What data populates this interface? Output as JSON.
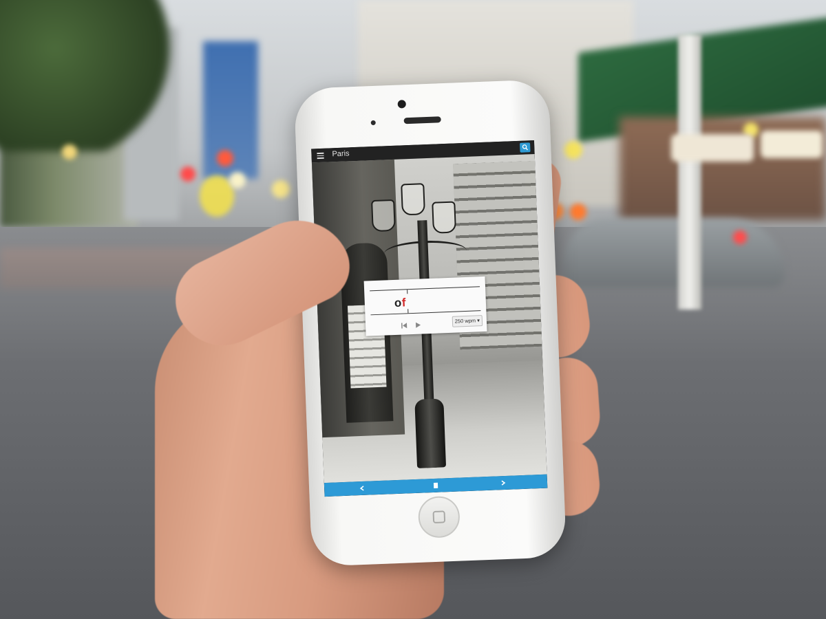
{
  "app": {
    "title": "Paris"
  },
  "reader": {
    "word_pre": "o",
    "word_pivot": "f",
    "word_post": "",
    "speed_label": "250 wpm ▾"
  },
  "icons": {
    "menu": "hamburger-icon",
    "search": "search-icon",
    "rewind": "skip-back-icon",
    "play": "play-icon",
    "prev": "chevron-left-icon",
    "bookmark": "bookmark-icon",
    "next": "chevron-right-icon"
  },
  "colors": {
    "accent": "#2d9ad6",
    "pivot_letter": "#d12a2a",
    "topbar": "#222222"
  }
}
